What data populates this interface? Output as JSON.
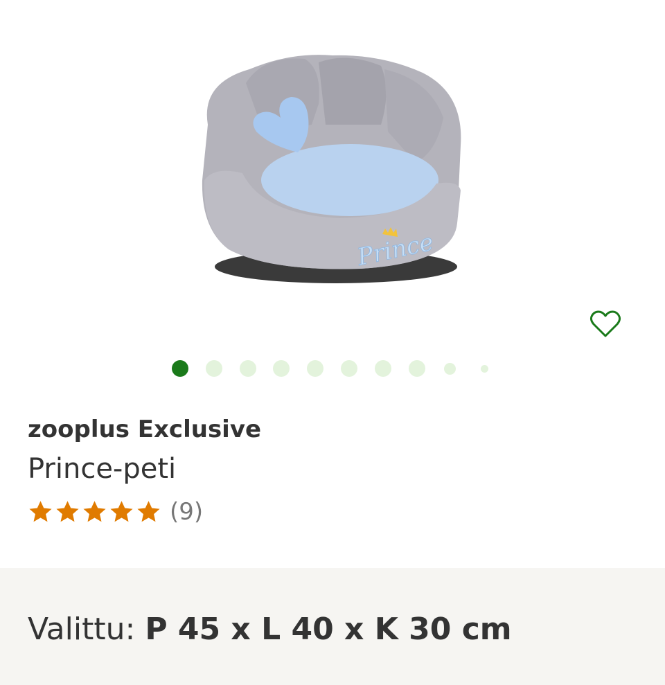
{
  "product": {
    "brand": "zooplus Exclusive",
    "name": "Prince-peti",
    "rating": {
      "stars": 5,
      "max_stars": 5,
      "review_count_text": "(9)"
    },
    "image_embroidery": "Prince"
  },
  "gallery": {
    "total_images": 10,
    "active_index": 0,
    "favorite_icon": "heart-outline-icon"
  },
  "variant": {
    "label": "Valittu:",
    "value": "P 45 x L 40 x K 30 cm"
  },
  "colors": {
    "accent_green": "#1a7a1a",
    "dot_inactive": "#e3f3dc",
    "star_orange": "#e07b00",
    "variant_bg": "#f6f5f2",
    "text_dark": "#333333",
    "text_muted": "#777777"
  }
}
